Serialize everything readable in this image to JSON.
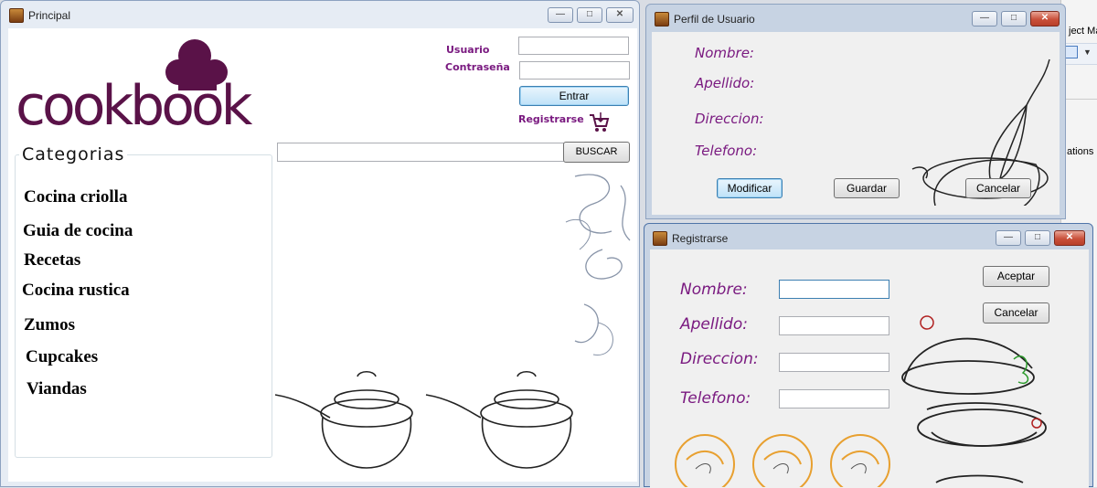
{
  "background_app": {
    "text_top": "ject Ma",
    "text_mid": "ations"
  },
  "principal": {
    "title": "Principal",
    "logo": "cookbook",
    "login": {
      "usuario_label": "Usuario",
      "password_label": "Contraseña",
      "usuario_value": "",
      "password_value": "",
      "enter_button": "Entrar",
      "register_link": "Registrarse"
    },
    "search": {
      "value": "",
      "button": "BUSCAR"
    },
    "categories": {
      "title": "Categorias",
      "items": [
        "Cocina criolla",
        "Guia de cocina",
        "Recetas",
        "Cocina rustica",
        "Zumos",
        "Cupcakes",
        "Viandas"
      ]
    }
  },
  "perfil": {
    "title": "Perfil de Usuario",
    "labels": {
      "nombre": "Nombre:",
      "apellido": "Apellido:",
      "direccion": "Direccion:",
      "telefono": "Telefono:"
    },
    "buttons": {
      "modificar": "Modificar",
      "guardar": "Guardar",
      "cancelar": "Cancelar"
    }
  },
  "registro": {
    "title": "Registrarse",
    "labels": {
      "nombre": "Nombre:",
      "apellido": "Apellido:",
      "direccion": "Direccion:",
      "telefono": "Telefono:"
    },
    "values": {
      "nombre": "",
      "apellido": "",
      "direccion": "",
      "telefono": ""
    },
    "buttons": {
      "aceptar": "Aceptar",
      "cancelar": "Cancelar"
    }
  },
  "window_controls": {
    "minimize": "—",
    "maximize": "□",
    "close": "✕"
  },
  "colors": {
    "accent_purple": "#7a1a80",
    "logo_plum": "#5a1248",
    "focus_blue": "#3c7fb1",
    "orange_illustration": "#e8a030"
  }
}
